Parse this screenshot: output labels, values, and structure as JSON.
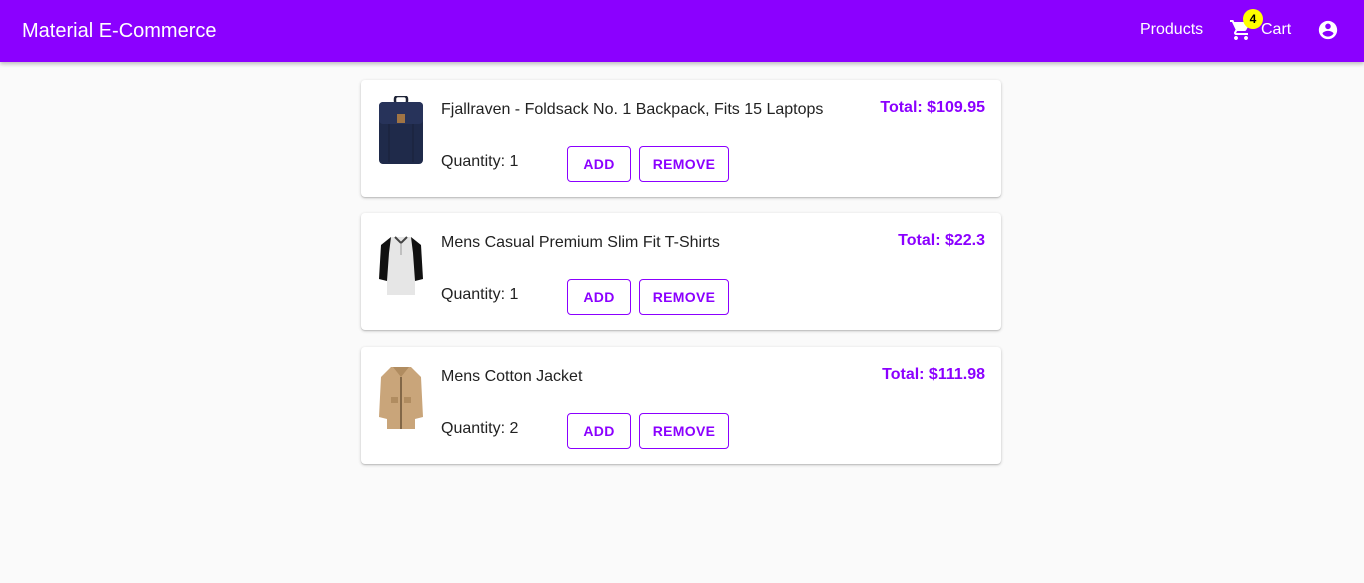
{
  "header": {
    "brand": "Material E-Commerce",
    "products_label": "Products",
    "cart_label": "Cart",
    "cart_count": "4",
    "accent_color": "#8b00ff",
    "badge_color": "#ffff00"
  },
  "cart": {
    "items": [
      {
        "title": "Fjallraven - Foldsack No. 1 Backpack, Fits 15 Laptops",
        "total": "Total: $109.95",
        "quantity": "Quantity: 1",
        "add_label": "ADD",
        "remove_label": "REMOVE",
        "image": "backpack-image"
      },
      {
        "title": "Mens Casual Premium Slim Fit T-Shirts",
        "total": "Total: $22.3",
        "quantity": "Quantity: 1",
        "add_label": "ADD",
        "remove_label": "REMOVE",
        "image": "tshirt-image"
      },
      {
        "title": "Mens Cotton Jacket",
        "total": "Total: $111.98",
        "quantity": "Quantity: 2",
        "add_label": "ADD",
        "remove_label": "REMOVE",
        "image": "jacket-image"
      }
    ]
  }
}
